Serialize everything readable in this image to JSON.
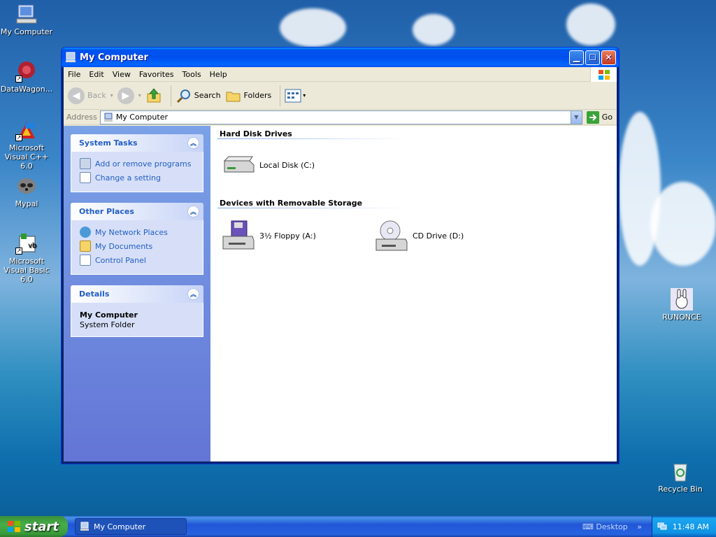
{
  "desktop": {
    "icons": [
      {
        "label": "My Computer"
      },
      {
        "label": "DataWagon..."
      },
      {
        "label": "Microsoft Visual C++ 6.0"
      },
      {
        "label": "Mypal"
      },
      {
        "label": "Microsoft Visual Basic 6.0"
      },
      {
        "label": "RUNONCE"
      },
      {
        "label": "Recycle Bin"
      }
    ]
  },
  "window": {
    "title": "My Computer",
    "menu": [
      "File",
      "Edit",
      "View",
      "Favorites",
      "Tools",
      "Help"
    ],
    "toolbar": {
      "back": "Back",
      "search": "Search",
      "folders": "Folders"
    },
    "address": {
      "label": "Address",
      "value": "My Computer",
      "go": "Go"
    },
    "taskpane": {
      "system_tasks": {
        "title": "System Tasks",
        "items": [
          "Add or remove programs",
          "Change a setting"
        ]
      },
      "other_places": {
        "title": "Other Places",
        "items": [
          "My Network Places",
          "My Documents",
          "Control Panel"
        ]
      },
      "details": {
        "title": "Details",
        "name": "My Computer",
        "type": "System Folder"
      }
    },
    "groups": {
      "hard_disks": {
        "title": "Hard Disk Drives",
        "items": [
          "Local Disk (C:)"
        ]
      },
      "removable": {
        "title": "Devices with Removable Storage",
        "items": [
          "3½ Floppy (A:)",
          "CD Drive (D:)"
        ]
      }
    }
  },
  "taskbar": {
    "start": "start",
    "active_task": "My Computer",
    "desktop_label": "Desktop",
    "clock": "11:48 AM"
  }
}
